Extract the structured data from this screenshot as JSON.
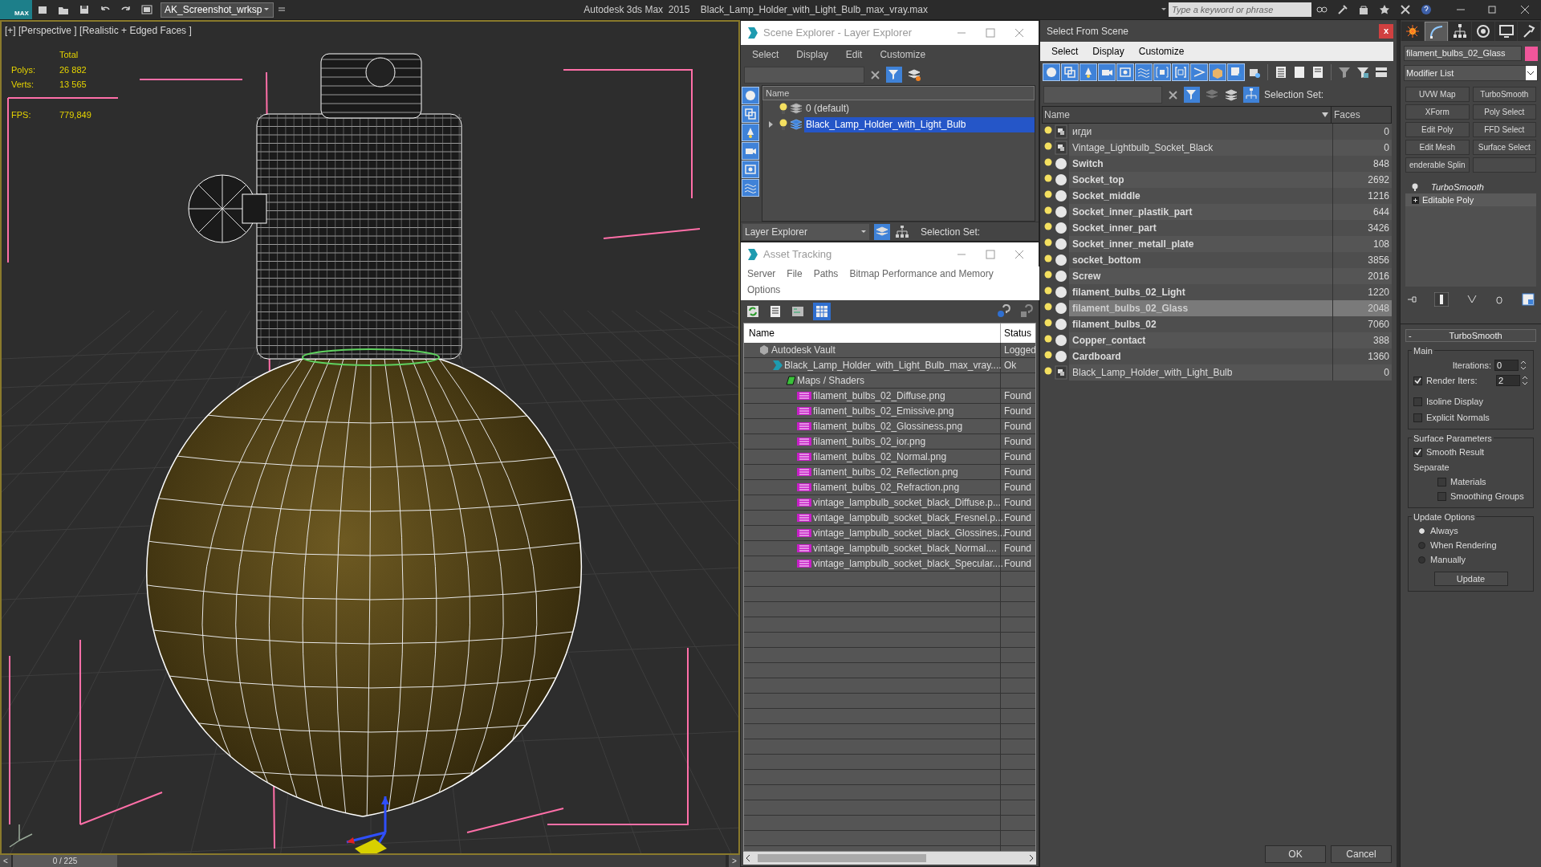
{
  "title_bar": {
    "logo": "MAX",
    "workspace": "AK_Screenshot_wrksp",
    "title": "Autodesk 3ds Max  2015    Black_Lamp_Holder_with_Light_Bulb_max_vray.max",
    "search": {
      "placeholder": "Type a keyword or phrase"
    }
  },
  "viewport": {
    "label": "[+] [Perspective ] [Realistic + Edged Faces ]",
    "stats_header": "Total",
    "stats": [
      {
        "label": "Polys:",
        "value": "26 882"
      },
      {
        "label": "Verts:",
        "value": "13 565"
      },
      {
        "label": "FPS:",
        "value": "779,849"
      }
    ]
  },
  "timeline": {
    "prev": "<",
    "counter": "0 / 225",
    "level": 0,
    "next": ">"
  },
  "scene_explorer": {
    "title": "Scene Explorer - Layer Explorer",
    "menu": [
      "Select",
      "Display",
      "Edit",
      "Customize"
    ],
    "column": "Name",
    "filters": [
      {
        "kind": "geometry",
        "on": true
      },
      {
        "kind": "shapes",
        "on": true
      },
      {
        "kind": "lights",
        "on": true
      },
      {
        "kind": "cameras",
        "on": true
      },
      {
        "kind": "helpers",
        "on": true
      },
      {
        "kind": "spacewarps",
        "on": true
      }
    ],
    "layers": [
      {
        "name": "0 (default)",
        "expandable": false,
        "selected": false
      },
      {
        "name": "Black_Lamp_Holder_with_Light_Bulb",
        "expandable": true,
        "selected": true
      }
    ],
    "mode": "Layer Explorer",
    "selection_set_label": "Selection Set:"
  },
  "asset_tracking": {
    "title": "Asset Tracking",
    "menu": [
      "Server",
      "File",
      "Paths",
      "Bitmap Performance and Memory",
      "Options"
    ],
    "columns": [
      "Name",
      "Status"
    ],
    "rows": [
      {
        "kind": "vault",
        "name": "Autodesk Vault",
        "status": "Logged",
        "children": [
          {
            "kind": "max",
            "name": "Black_Lamp_Holder_with_Light_Bulb_max_vray....",
            "status": "Ok",
            "children": [
              {
                "kind": "folder",
                "name": "Maps / Shaders",
                "children": [
                  {
                    "kind": "png",
                    "name": "filament_bulbs_02_Diffuse.png",
                    "status": "Found"
                  },
                  {
                    "kind": "png",
                    "name": "filament_bulbs_02_Emissive.png",
                    "status": "Found"
                  },
                  {
                    "kind": "png",
                    "name": "filament_bulbs_02_Glossiness.png",
                    "status": "Found"
                  },
                  {
                    "kind": "png",
                    "name": "filament_bulbs_02_ior.png",
                    "status": "Found"
                  },
                  {
                    "kind": "png",
                    "name": "filament_bulbs_02_Normal.png",
                    "status": "Found"
                  },
                  {
                    "kind": "png",
                    "name": "filament_bulbs_02_Reflection.png",
                    "status": "Found"
                  },
                  {
                    "kind": "png",
                    "name": "filament_bulbs_02_Refraction.png",
                    "status": "Found"
                  },
                  {
                    "kind": "png",
                    "name": "vintage_lampbulb_socket_black_Diffuse.p...",
                    "status": "Found"
                  },
                  {
                    "kind": "png",
                    "name": "vintage_lampbulb_socket_black_Fresnel.p...",
                    "status": "Found"
                  },
                  {
                    "kind": "png",
                    "name": "vintage_lampbulb_socket_black_Glossines...",
                    "status": "Found"
                  },
                  {
                    "kind": "png",
                    "name": "vintage_lampbulb_socket_black_Normal....",
                    "status": "Found"
                  },
                  {
                    "kind": "png",
                    "name": "vintage_lampbulb_socket_black_Specular....",
                    "status": "Found"
                  }
                ]
              }
            ]
          }
        ]
      }
    ]
  },
  "select_from_scene": {
    "title": "Select From Scene",
    "close": "x",
    "menu": [
      "Select",
      "Display",
      "Customize"
    ],
    "filters": [
      {
        "kind": "geometry",
        "on": true
      },
      {
        "kind": "shapes",
        "on": true
      },
      {
        "kind": "lights",
        "on": true
      },
      {
        "kind": "cameras",
        "on": true
      },
      {
        "kind": "helpers",
        "on": true
      },
      {
        "kind": "spacewarps",
        "on": true
      },
      {
        "kind": "groups",
        "on": true
      },
      {
        "kind": "xrefs",
        "on": true
      },
      {
        "kind": "bones",
        "on": true
      },
      {
        "kind": "containers",
        "on": true
      },
      {
        "kind": "frozen",
        "on": true
      },
      {
        "kind": "hidden",
        "on": false
      }
    ],
    "selection_set_label": "Selection Set:",
    "columns": [
      "Name",
      "Faces"
    ],
    "rows": [
      {
        "kind": "group",
        "name": "игди",
        "faces": "0",
        "selected": false
      },
      {
        "kind": "group",
        "name": "Vintage_Lightbulb_Socket_Black",
        "faces": "0",
        "selected": false
      },
      {
        "kind": "object",
        "name": "Switch",
        "faces": "848",
        "selected": false
      },
      {
        "kind": "object",
        "name": "Socket_top",
        "faces": "2692",
        "selected": false
      },
      {
        "kind": "object",
        "name": "Socket_middle",
        "faces": "1216",
        "selected": false
      },
      {
        "kind": "object",
        "name": "Socket_inner_plastik_part",
        "faces": "644",
        "selected": false
      },
      {
        "kind": "object",
        "name": "Socket_inner_part",
        "faces": "3426",
        "selected": false
      },
      {
        "kind": "object",
        "name": "Socket_inner_metall_plate",
        "faces": "108",
        "selected": false
      },
      {
        "kind": "object",
        "name": "socket_bottom",
        "faces": "3856",
        "selected": false
      },
      {
        "kind": "object",
        "name": "Screw",
        "faces": "2016",
        "selected": false
      },
      {
        "kind": "object",
        "name": "filament_bulbs_02_Light",
        "faces": "1220",
        "selected": false
      },
      {
        "kind": "object",
        "name": "filament_bulbs_02_Glass",
        "faces": "2048",
        "selected": true
      },
      {
        "kind": "object",
        "name": "filament_bulbs_02",
        "faces": "7060",
        "selected": false
      },
      {
        "kind": "object",
        "name": "Copper_contact",
        "faces": "388",
        "selected": false
      },
      {
        "kind": "object",
        "name": "Cardboard",
        "faces": "1360",
        "selected": false
      },
      {
        "kind": "group",
        "name": "Black_Lamp_Holder_with_Light_Bulb",
        "faces": "0",
        "selected": false
      }
    ],
    "buttons": [
      "OK",
      "Cancel"
    ]
  },
  "command_panel": {
    "tabs": [
      {
        "kind": "create",
        "selected": false
      },
      {
        "kind": "modify",
        "selected": true
      },
      {
        "kind": "hierarchy",
        "selected": false
      },
      {
        "kind": "motion",
        "selected": false
      },
      {
        "kind": "display",
        "selected": false
      },
      {
        "kind": "utilities",
        "selected": false
      }
    ],
    "object_name": "filament_bulbs_02_Glass",
    "modifier_list": "Modifier List",
    "modifier_buttons": [
      "UVW Map",
      "TurboSmooth",
      "XForm",
      "Poly Select",
      "Edit Poly",
      "FFD Select",
      "Edit Mesh",
      "Surface Select",
      "enderable Splin"
    ],
    "stack": [
      {
        "kind": "modifier",
        "name": "TurboSmooth"
      },
      {
        "kind": "base",
        "name": "Editable Poly"
      }
    ],
    "rollout": {
      "title": "TurboSmooth",
      "collapse": "-",
      "main_label": "Main",
      "iterations": {
        "label": "Iterations:",
        "value": "0"
      },
      "render_iters": {
        "label": "Render Iters:",
        "value": "2",
        "checked": true
      },
      "isoline": {
        "label": "Isoline Display",
        "checked": false
      },
      "explicit_normals": {
        "label": "Explicit Normals",
        "checked": false
      },
      "surface_label": "Surface Parameters",
      "smooth_result": {
        "label": "Smooth Result",
        "checked": true
      },
      "separate_label": "Separate",
      "materials": {
        "label": "Materials",
        "checked": false
      },
      "smoothing_groups": {
        "label": "Smoothing Groups",
        "checked": false
      },
      "update_label": "Update Options",
      "update_options": [
        {
          "label": "Always",
          "selected": true
        },
        {
          "label": "When Rendering",
          "selected": false
        },
        {
          "label": "Manually",
          "selected": false
        }
      ],
      "update_button": "Update"
    }
  }
}
